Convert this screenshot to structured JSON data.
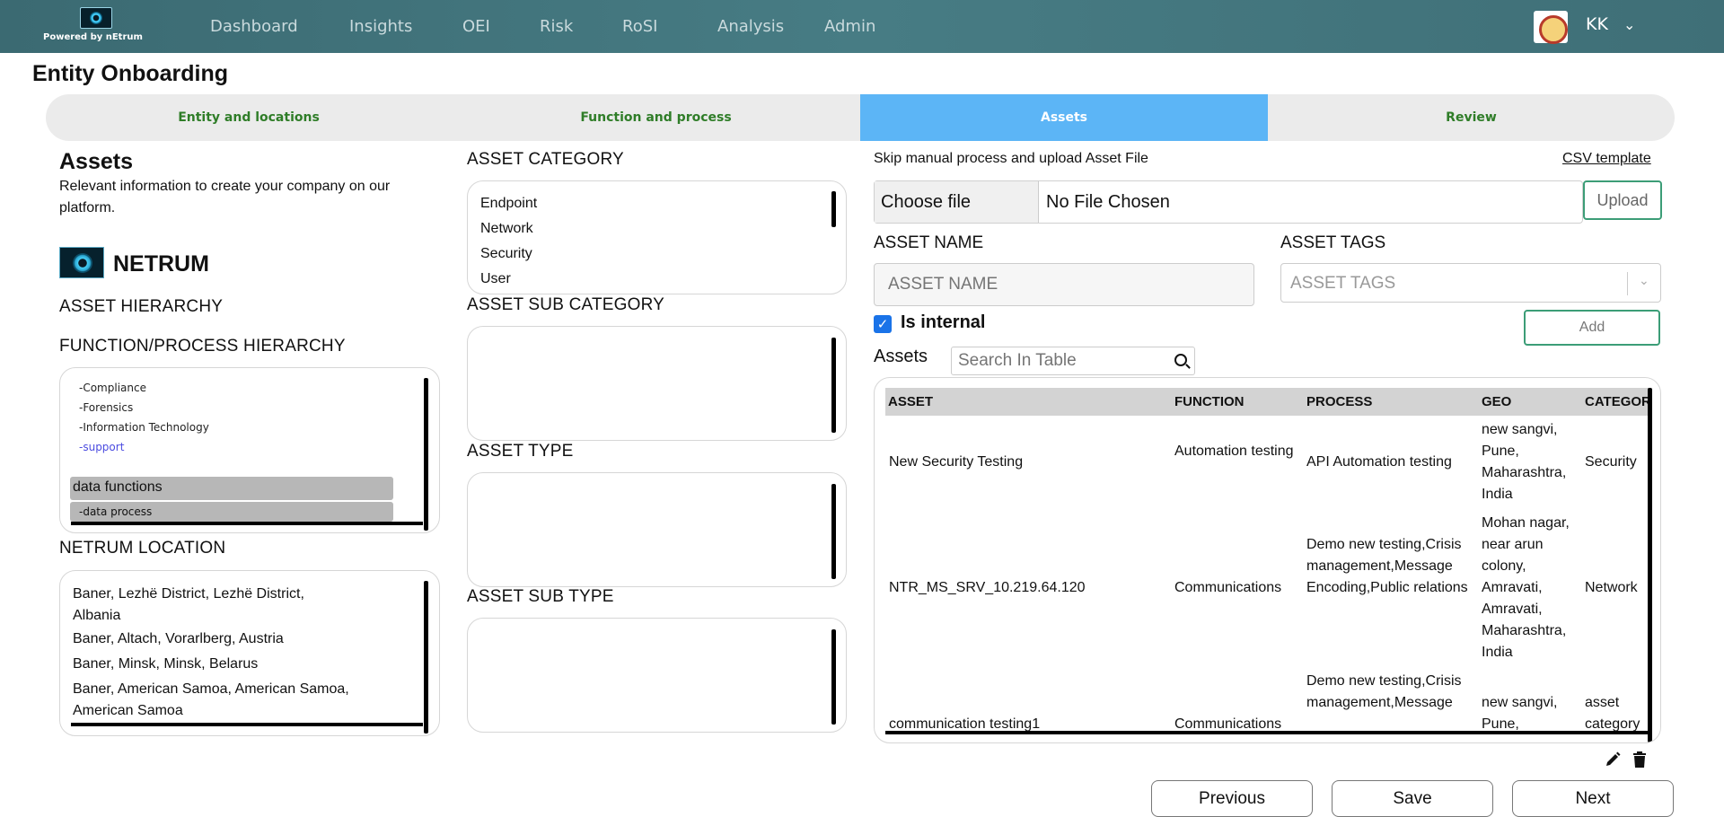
{
  "app": {
    "powered_by": "Powered by nEtrum",
    "nav": [
      "Dashboard",
      "Insights",
      "OEI",
      "Risk",
      "RoSI",
      "Analysis",
      "Admin"
    ],
    "user_initials": "KK"
  },
  "page": {
    "title": "Entity Onboarding",
    "steps": [
      "Entity and locations",
      "Function and process",
      "Assets",
      "Review"
    ],
    "active_step": "Assets"
  },
  "left": {
    "heading": "Assets",
    "description": "Relevant information to create your company on our platform.",
    "company_name": "NETRUM",
    "asset_hierarchy_label": "ASSET HIERARCHY",
    "function_hierarchy_label": "FUNCTION/PROCESS HIERARCHY",
    "function_items": [
      "-Compliance",
      "-Forensics",
      "-Information Technology",
      "-support"
    ],
    "selected_function": "data functions",
    "selected_process": "-data process",
    "location_label": "NETRUM LOCATION",
    "locations": [
      "Baner, Lezhë District, Lezhë District, Albania",
      "Baner, Altach, Vorarlberg, Austria",
      "Baner, Minsk, Minsk, Belarus",
      "Baner, American Samoa, American Samoa, American Samoa"
    ]
  },
  "middle": {
    "category_label": "ASSET CATEGORY",
    "categories": [
      "Endpoint",
      "Network",
      "Security",
      "User"
    ],
    "sub_category_label": "ASSET SUB CATEGORY",
    "type_label": "ASSET TYPE",
    "sub_type_label": "ASSET SUB TYPE"
  },
  "right": {
    "skip_text": "Skip manual process and upload Asset File",
    "csv_link": "CSV template",
    "choose_file": "Choose file",
    "no_file": "No File Chosen",
    "upload": "Upload",
    "asset_name_label": "ASSET NAME",
    "asset_name_placeholder": "ASSET NAME",
    "asset_tags_label": "ASSET TAGS",
    "asset_tags_placeholder": "ASSET TAGS",
    "is_internal": "Is internal",
    "is_internal_checked": true,
    "add": "Add",
    "assets_label": "Assets",
    "search_placeholder": "Search In Table",
    "columns": [
      "ASSET",
      "FUNCTION",
      "PROCESS",
      "GEO",
      "CATEGORY"
    ],
    "rows": [
      {
        "asset": "New Security Testing",
        "function": "Automation testing",
        "process": "API Automation testing",
        "geo": "new sangvi, Pune, Maharashtra, India",
        "category": "Security"
      },
      {
        "asset": "NTR_MS_SRV_10.219.64.120",
        "function": "Communications",
        "process": "Demo new testing,Crisis management,Message Encoding,Public relations",
        "geo": "Mohan nagar, near arun colony, Amravati, Amravati, Maharashtra, India",
        "category": "Network"
      },
      {
        "asset": "communication testing1",
        "function": "Communications",
        "process": "Demo new testing,Crisis management,Message",
        "geo": "new sangvi, Pune,",
        "category": "asset category"
      }
    ]
  },
  "footer": {
    "previous": "Previous",
    "save": "Save",
    "next": "Next"
  },
  "colors": {
    "topbar": "#477c84",
    "active_step": "#5cb5f6",
    "step_text": "#2f7d28",
    "accent_border": "#3c9d77"
  }
}
